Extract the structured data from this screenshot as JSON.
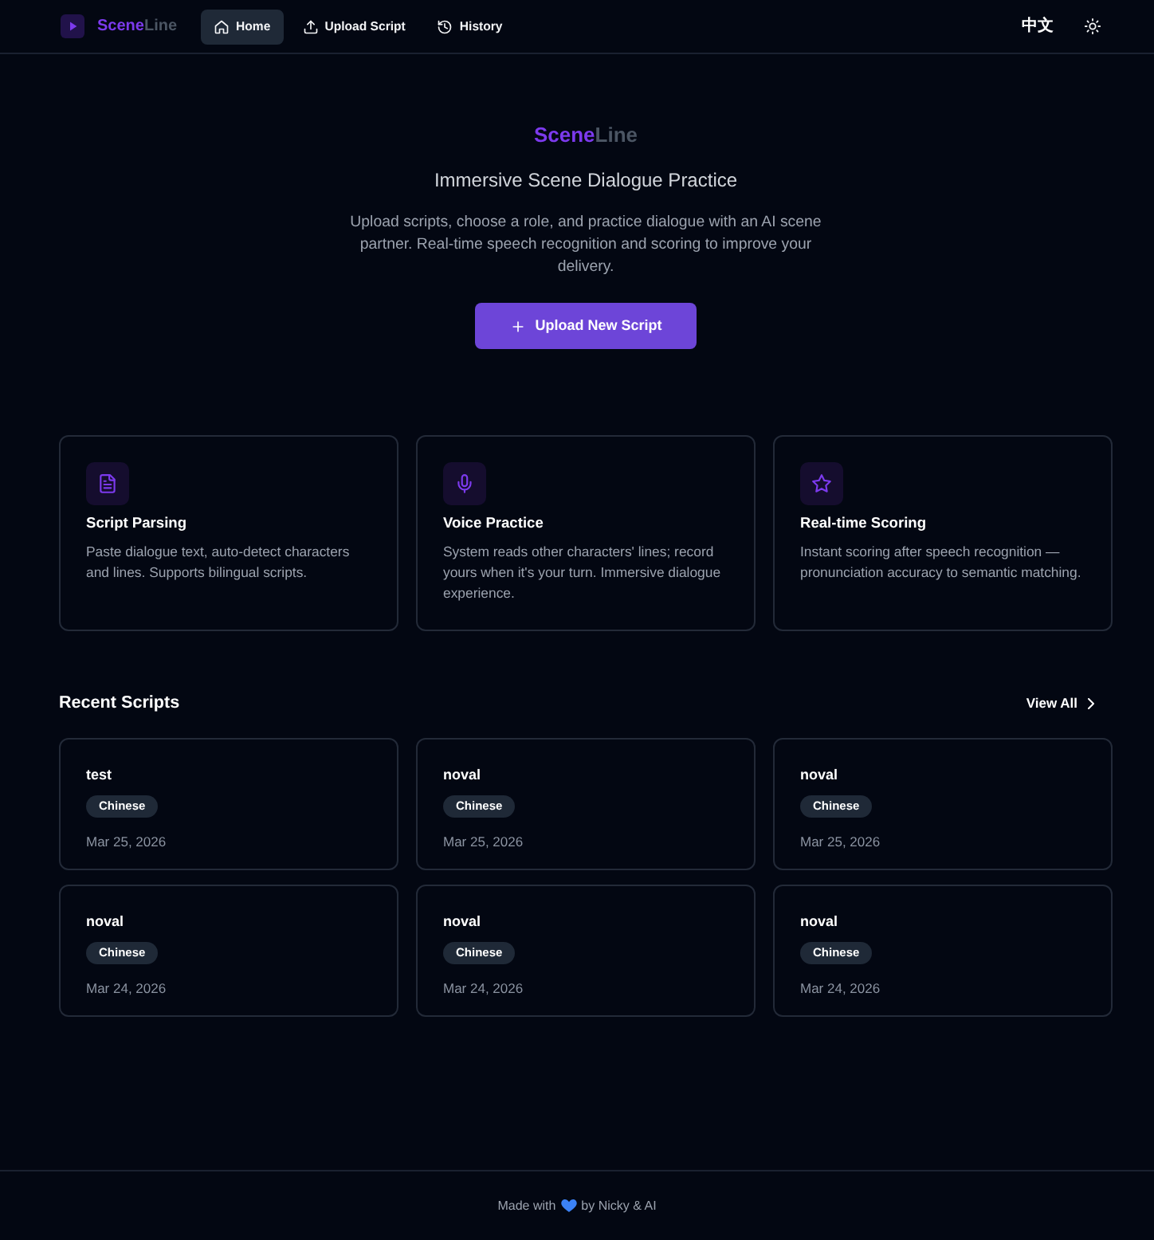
{
  "navbar": {
    "brand": {
      "accent": "Scene",
      "rest": "Line"
    },
    "links": [
      {
        "label": "Home",
        "selected": true
      },
      {
        "label": "Upload Script",
        "selected": false
      },
      {
        "label": "History",
        "selected": false
      }
    ],
    "language": "中文"
  },
  "hero": {
    "brand": {
      "accent": "Scene",
      "rest": "Line"
    },
    "title": "Immersive Scene Dialogue Practice",
    "description": "Upload scripts, choose a role, and practice dialogue with an AI scene partner. Real-time speech recognition and scoring to improve your delivery.",
    "button": "Upload New Script"
  },
  "features": [
    {
      "kind": "document",
      "title": "Script Parsing",
      "description": "Paste dialogue text, auto-detect characters and lines. Supports bilingual scripts."
    },
    {
      "kind": "microphone",
      "title": "Voice Practice",
      "description": "System reads other characters' lines; record yours when it's your turn. Immersive dialogue experience."
    },
    {
      "kind": "star",
      "title": "Real-time Scoring",
      "description": "Instant scoring after speech recognition — pronunciation accuracy to semantic matching."
    }
  ],
  "recent_scripts": {
    "title": "Recent Scripts",
    "view_all": "View All",
    "items": [
      {
        "title": "test",
        "language": "Chinese",
        "date": "Mar 25, 2026"
      },
      {
        "title": "noval",
        "language": "Chinese",
        "date": "Mar 25, 2026"
      },
      {
        "title": "noval",
        "language": "Chinese",
        "date": "Mar 25, 2026"
      },
      {
        "title": "noval",
        "language": "Chinese",
        "date": "Mar 24, 2026"
      },
      {
        "title": "noval",
        "language": "Chinese",
        "date": "Mar 24, 2026"
      },
      {
        "title": "noval",
        "language": "Chinese",
        "date": "Mar 24, 2026"
      }
    ]
  },
  "footer": {
    "before": "Made with",
    "after": "by Nicky & AI"
  }
}
